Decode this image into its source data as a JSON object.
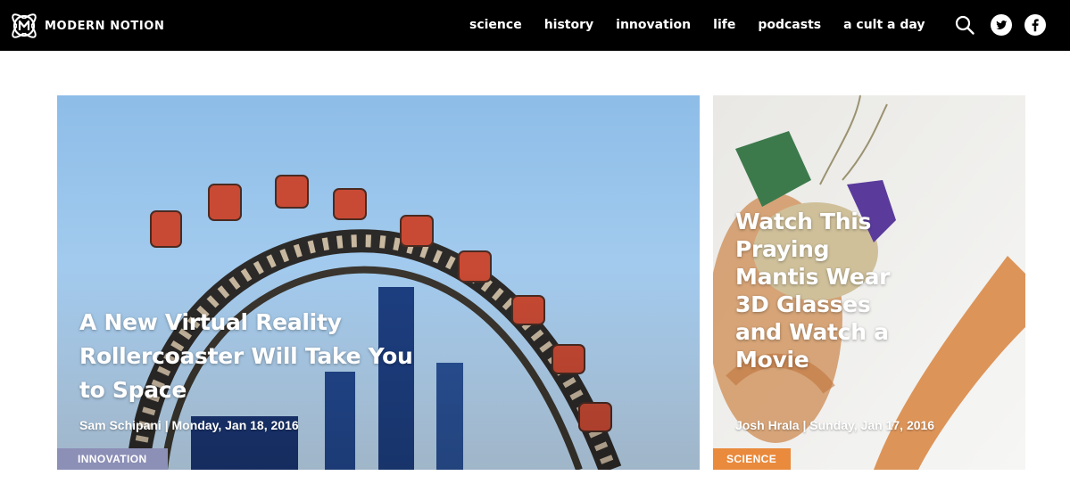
{
  "header": {
    "brand": "MODERN NOTION",
    "logo_icon": "modern-notion-logo-icon",
    "nav": [
      {
        "label": "science"
      },
      {
        "label": "history"
      },
      {
        "label": "innovation"
      },
      {
        "label": "life"
      },
      {
        "label": "podcasts"
      },
      {
        "label": "a cult a day"
      }
    ],
    "icons": {
      "search": "search-icon",
      "twitter": "twitter-icon",
      "facebook": "facebook-icon"
    }
  },
  "articles": [
    {
      "title": "A New Virtual Reality Rollercoaster Will Take You to Space",
      "byline": "Sam Schipani | Monday, Jan 18, 2016",
      "category": "INNOVATION",
      "category_color": "#8c8fb6"
    },
    {
      "title": "Watch This Praying Mantis Wear 3D Glasses and Watch a Movie",
      "byline": "Josh Hrala | Sunday, Jan 17, 2016",
      "category": "SCIENCE",
      "category_color": "#e98a3c"
    }
  ],
  "colors": {
    "header_bg": "#000000",
    "page_bg": "#ffffff",
    "text_on_image": "#ffffff"
  }
}
